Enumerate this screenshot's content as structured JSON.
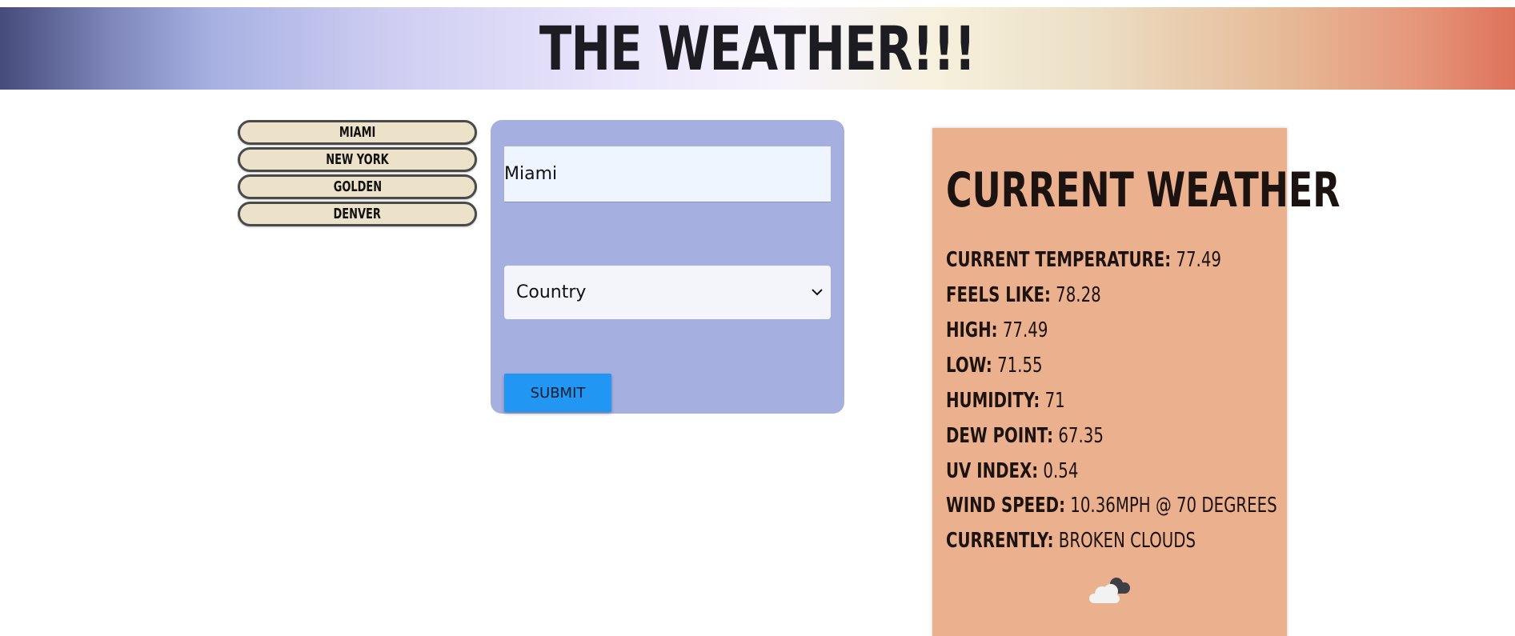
{
  "header": {
    "title": "THE WEATHER!!!"
  },
  "saved_cities": [
    {
      "label": "MIAMI"
    },
    {
      "label": "NEW YORK"
    },
    {
      "label": "GOLDEN"
    },
    {
      "label": "DENVER"
    }
  ],
  "search_form": {
    "city_value": "Miami",
    "country_selected": "Country",
    "submit_label": "SUBMIT"
  },
  "current_weather": {
    "heading": "CURRENT WEATHER",
    "stats": [
      {
        "label": "CURRENT TEMPERATURE:",
        "value": "77.49"
      },
      {
        "label": "FEELS LIKE:",
        "value": "78.28"
      },
      {
        "label": "HIGH:",
        "value": "77.49"
      },
      {
        "label": "LOW:",
        "value": "71.55"
      },
      {
        "label": "HUMIDITY:",
        "value": "71"
      },
      {
        "label": "DEW POINT:",
        "value": "67.35"
      },
      {
        "label": "UV INDEX:",
        "value": "0.54"
      },
      {
        "label": "WIND SPEED:",
        "value": "10.36mph @ 70 degrees"
      },
      {
        "label": "CURRENTLY:",
        "value": "broken clouds"
      }
    ],
    "icon": "broken-clouds-icon"
  }
}
